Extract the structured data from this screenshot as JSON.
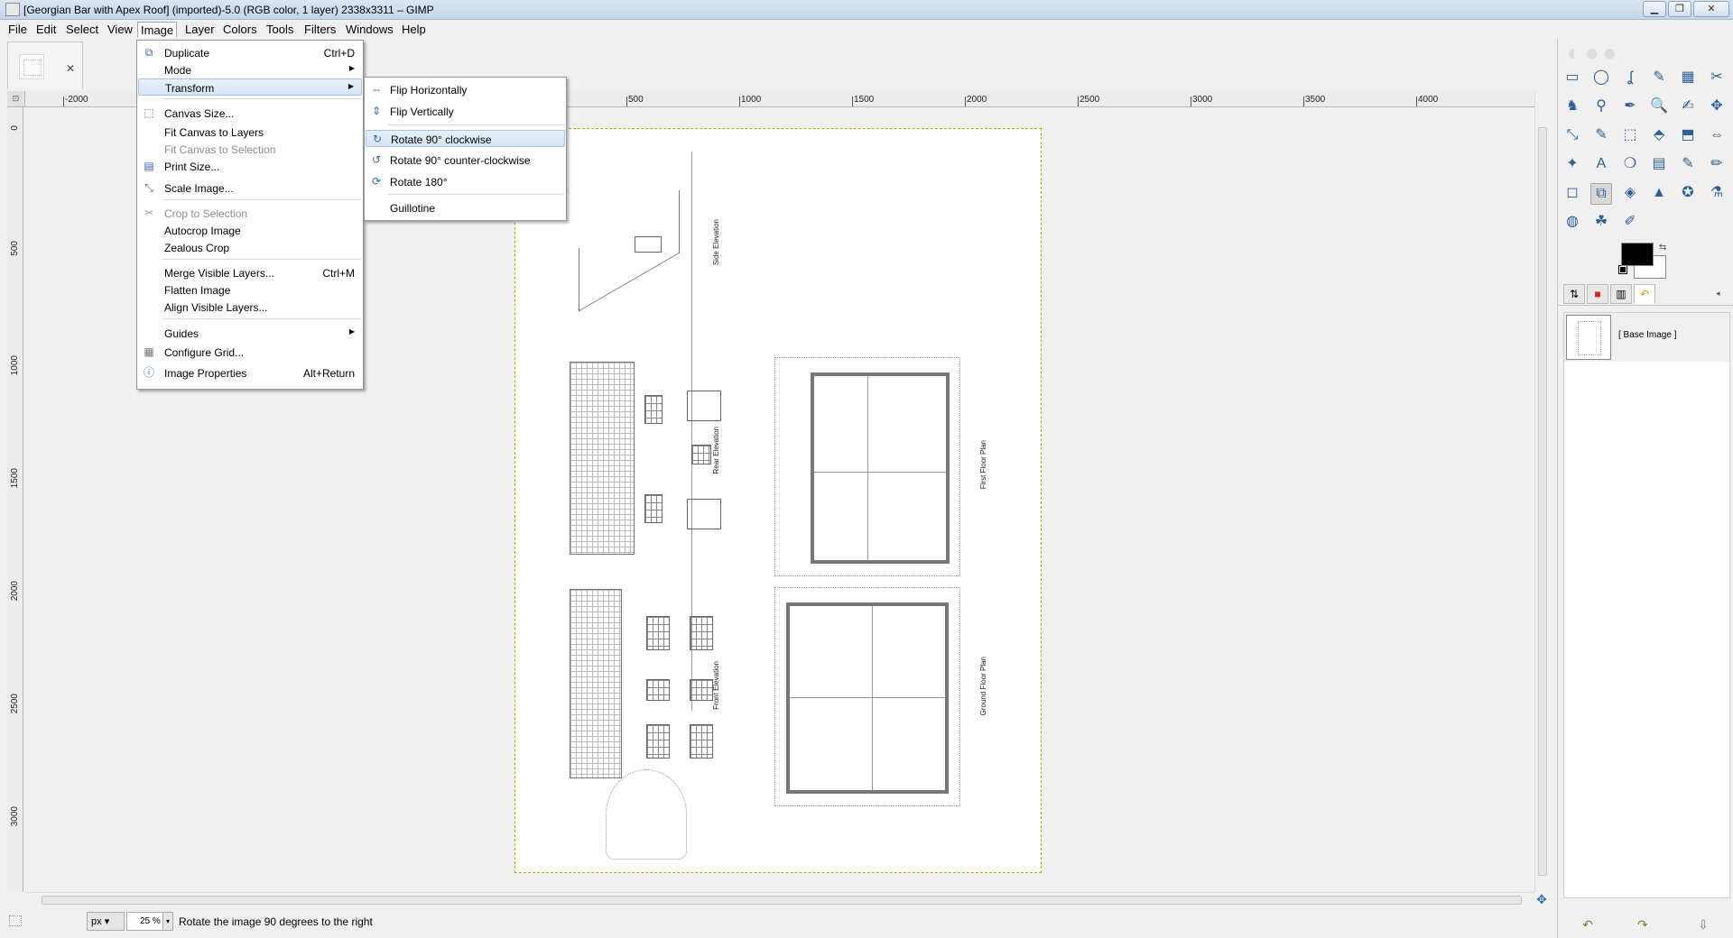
{
  "window": {
    "title": "[Georgian Bar with Apex Roof] (imported)-5.0 (RGB color, 1 layer) 2338x3311 – GIMP",
    "min_symbol": "▁",
    "max_symbol": "❐",
    "close_symbol": "✕"
  },
  "menubar": [
    "File",
    "Edit",
    "Select",
    "View",
    "Image",
    "Layer",
    "Colors",
    "Tools",
    "Filters",
    "Windows",
    "Help"
  ],
  "image_tab": {
    "close_symbol": "✕"
  },
  "rulers": {
    "corner_symbol": "⊡",
    "top_labels": [
      "-2000",
      "500",
      "1000",
      "1500",
      "2000",
      "2500",
      "3000",
      "3500",
      "4000"
    ],
    "left_labels": [
      "0",
      "500",
      "1000",
      "1500",
      "2000",
      "2500",
      "3000"
    ]
  },
  "document": {
    "labels": {
      "side_elevation": "Side Elevation",
      "rear_elevation": "Rear Elevation",
      "front_elevation": "Front Elevation",
      "first_floor_plan": "First Floor Plan",
      "ground_floor_plan": "Ground Floor Plan"
    }
  },
  "image_menu": {
    "items": [
      {
        "label": "Duplicate",
        "shortcut": "Ctrl+D",
        "icon": "duplicate-icon"
      },
      {
        "label": "Mode",
        "submenu": true
      },
      {
        "label": "Transform",
        "submenu": true
      },
      {
        "label": "Canvas Size...",
        "icon": "canvas-size-icon"
      },
      {
        "label": "Fit Canvas to Layers"
      },
      {
        "label": "Fit Canvas to Selection",
        "disabled": true
      },
      {
        "label": "Print Size...",
        "icon": "print-size-icon"
      },
      {
        "label": "Scale Image...",
        "icon": "scale-image-icon"
      },
      {
        "label": "Crop to Selection",
        "disabled": true,
        "icon": "crop-icon"
      },
      {
        "label": "Autocrop Image"
      },
      {
        "label": "Zealous Crop"
      },
      {
        "label": "Merge Visible Layers...",
        "shortcut": "Ctrl+M"
      },
      {
        "label": "Flatten Image"
      },
      {
        "label": "Align Visible Layers..."
      },
      {
        "label": "Guides",
        "submenu": true
      },
      {
        "label": "Configure Grid...",
        "icon": "grid-icon"
      },
      {
        "label": "Image Properties",
        "shortcut": "Alt+Return",
        "icon": "info-icon"
      }
    ],
    "submenu_arrow": "▶"
  },
  "transform_menu": {
    "items": [
      {
        "label": "Flip Horizontally",
        "icon": "flip-horizontal-icon"
      },
      {
        "label": "Flip Vertically",
        "icon": "flip-vertical-icon"
      },
      {
        "label": "Rotate 90° clockwise",
        "icon": "rotate-cw-icon",
        "highlighted": true
      },
      {
        "label": "Rotate 90° counter-clockwise",
        "icon": "rotate-ccw-icon"
      },
      {
        "label": "Rotate 180°",
        "icon": "rotate-180-icon"
      },
      {
        "label": "Guillotine"
      }
    ]
  },
  "statusbar": {
    "unit": "px",
    "unit_arrow": "▾",
    "zoom": "25 %",
    "zoom_arrow": "▾",
    "message": "Rotate the image 90 degrees to the right",
    "nav_symbol": "✥"
  },
  "dock": {
    "logo_text": "◐●●",
    "toolbox_icon_glyphs": [
      "▭",
      "◯",
      "ʆ",
      "✎",
      "▦",
      "✂",
      "♞",
      "⚲",
      "✒",
      "🔍",
      "✍",
      "✥",
      "⤡",
      "✎",
      "⬚",
      "⬘",
      "⬒",
      "⇔",
      "✦",
      "A",
      "❍",
      "▤",
      "✎",
      "✏",
      "◻",
      "⧉",
      "◈",
      "▲",
      "✪",
      "⚗",
      "◍",
      "☘",
      "✐"
    ],
    "swap_symbol": "⇆",
    "tab_glyphs": [
      "⇅",
      "■",
      "▥",
      "↶"
    ],
    "menu_btn": "◂",
    "images": [
      {
        "label": "[ Base Image ]"
      }
    ],
    "footer_glyphs": [
      "↶",
      "↷",
      "⇩"
    ]
  },
  "colors": {
    "foreground": "#000000",
    "background": "#ffffff",
    "highlight": "#d6e4f5",
    "selection_border": "#b8a800"
  }
}
